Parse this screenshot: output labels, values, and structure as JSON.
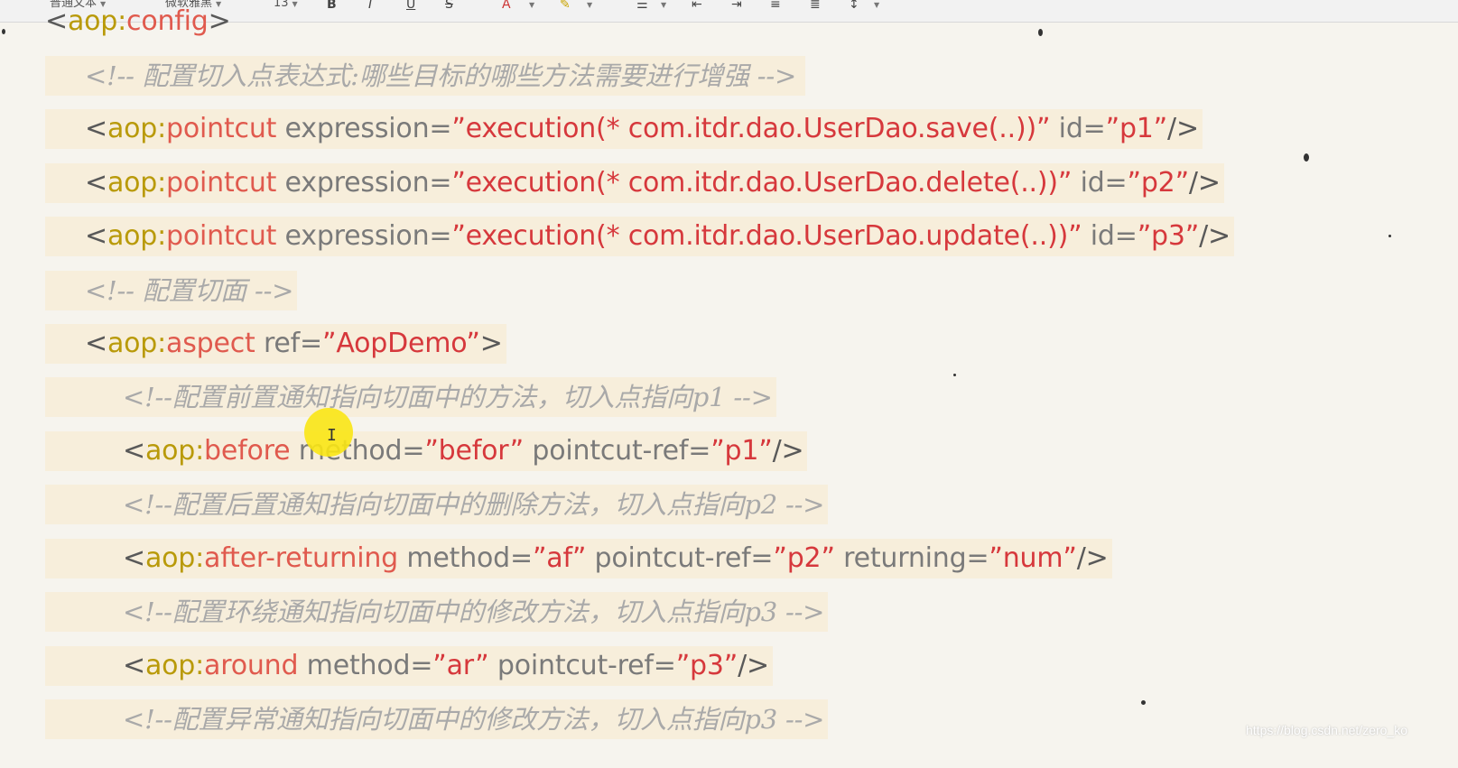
{
  "toolbar": {
    "style_label": "普通文本",
    "font_name": "微软雅黑",
    "font_size": "13",
    "bold_icon": "B",
    "italic_icon": "I",
    "underline_icon": "U",
    "strike_icon": "S",
    "font_color_icon": "A"
  },
  "code": {
    "config_open_lt": "<",
    "config_open_ns": "aop:",
    "config_open_tag": "config",
    "config_open_gt": ">",
    "comment1": "<!-- 配置切入点表达式:哪些目标的哪些方法需要进行增强 -->",
    "pc1_lt": "<",
    "pc1_ns": "aop:",
    "pc1_tag": "pointcut",
    "pc1_attr1": " expression=",
    "pc1_val1": "”execution(* com.itdr.dao.UserDao.save(..))”",
    "pc1_attr2": " id=",
    "pc1_val2": "”p1”",
    "pc1_end": "/>",
    "pc2_lt": "<",
    "pc2_ns": "aop:",
    "pc2_tag": "pointcut",
    "pc2_attr1": " expression=",
    "pc2_val1": "”execution(* com.itdr.dao.UserDao.delete(..))”",
    "pc2_attr2": " id=",
    "pc2_val2": "”p2”",
    "pc2_end": "/>",
    "pc3_lt": "<",
    "pc3_ns": "aop:",
    "pc3_tag": "pointcut",
    "pc3_attr1": " expression=",
    "pc3_val1": "”execution(* com.itdr.dao.UserDao.update(..))”",
    "pc3_attr2": " id=",
    "pc3_val2": "”p3”",
    "pc3_end": "/>",
    "comment2": "<!-- 配置切面 -->",
    "aspect_lt": "<",
    "aspect_ns": "aop:",
    "aspect_tag": "aspect",
    "aspect_attr": " ref=",
    "aspect_val": "”AopDemo”",
    "aspect_end": ">",
    "comment3": "<!--配置前置通知指向切面中的方法，切入点指向p1 -->",
    "before_lt": "<",
    "before_ns": "aop:",
    "before_tag": "before",
    "before_attr1": " method=",
    "before_val1": "”befor”",
    "before_attr2": " pointcut-ref=",
    "before_val2": "”p1”",
    "before_end": "/>",
    "comment4": "<!--配置后置通知指向切面中的删除方法，切入点指向p2 -->",
    "after_lt": "<",
    "after_ns": "aop:",
    "after_tag": "after-returning",
    "after_attr1": " method=",
    "after_val1": "”af”",
    "after_attr2": " pointcut-ref=",
    "after_val2": "”p2”",
    "after_attr3": " returning=",
    "after_val3": "”num”",
    "after_end": "/>",
    "comment5": "<!--配置环绕通知指向切面中的修改方法，切入点指向p3 -->",
    "around_lt": "<",
    "around_ns": "aop:",
    "around_tag": "around",
    "around_attr1": " method=",
    "around_val1": "”ar”",
    "around_attr2": " pointcut-ref=",
    "around_val2": "”p3”",
    "around_end": "/>",
    "comment6": "<!--配置异常通知指向切面中的修改方法，切入点指向p3 -->"
  },
  "watermark": "https://blog.csdn.net/zero_ko",
  "colors": {
    "namespace": "#b99a0a",
    "tag": "#e05a4e",
    "value": "#d6383c",
    "comment": "#a9a9a9",
    "highlight": "#f7eedb",
    "cursor_dot": "#fae614"
  }
}
